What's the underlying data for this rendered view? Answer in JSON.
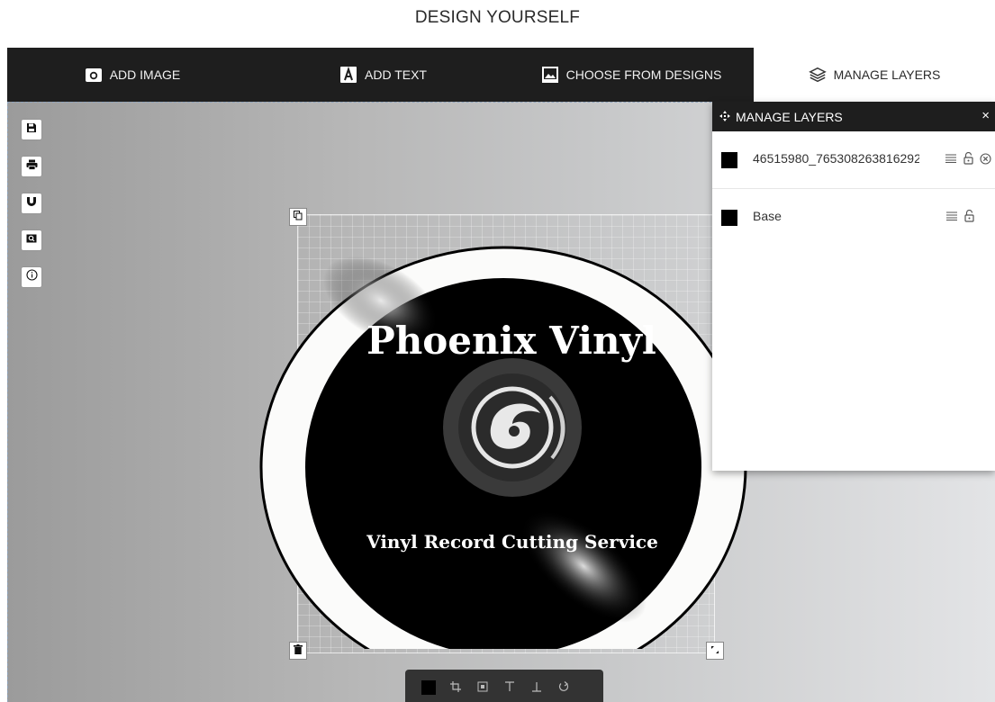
{
  "page": {
    "title": "DESIGN YOURSELF"
  },
  "tabs": [
    {
      "label": "ADD IMAGE",
      "icon": "camera-icon",
      "active": false
    },
    {
      "label": "ADD TEXT",
      "icon": "text-icon",
      "active": false
    },
    {
      "label": "CHOOSE FROM DESIGNS",
      "icon": "image-gallery-icon",
      "active": false
    },
    {
      "label": "MANAGE LAYERS",
      "icon": "layers-icon",
      "active": true
    }
  ],
  "side_tools": [
    {
      "name": "save-icon"
    },
    {
      "name": "print-icon"
    },
    {
      "name": "magnet-icon"
    },
    {
      "name": "zoom-icon"
    },
    {
      "name": "info-icon"
    }
  ],
  "design": {
    "title": "Phoenix Vinyl",
    "subtitle": "Vinyl Record Cutting Service"
  },
  "bottom_toolbar": {
    "color_swatch": "#000000",
    "tools": [
      "crop-icon",
      "center-icon",
      "align-top-icon",
      "align-bottom-icon",
      "reset-icon"
    ]
  },
  "layers_panel": {
    "title": "MANAGE LAYERS",
    "close": "×",
    "layers": [
      {
        "name": "46515980_765308263816292",
        "color": "#000000",
        "deletable": true
      },
      {
        "name": "Base",
        "color": "#000000",
        "deletable": false
      }
    ]
  },
  "colors": {
    "topbar": "#1e1e1e",
    "canvas_bg": "#b7b7b7",
    "record_black": "#000000"
  }
}
